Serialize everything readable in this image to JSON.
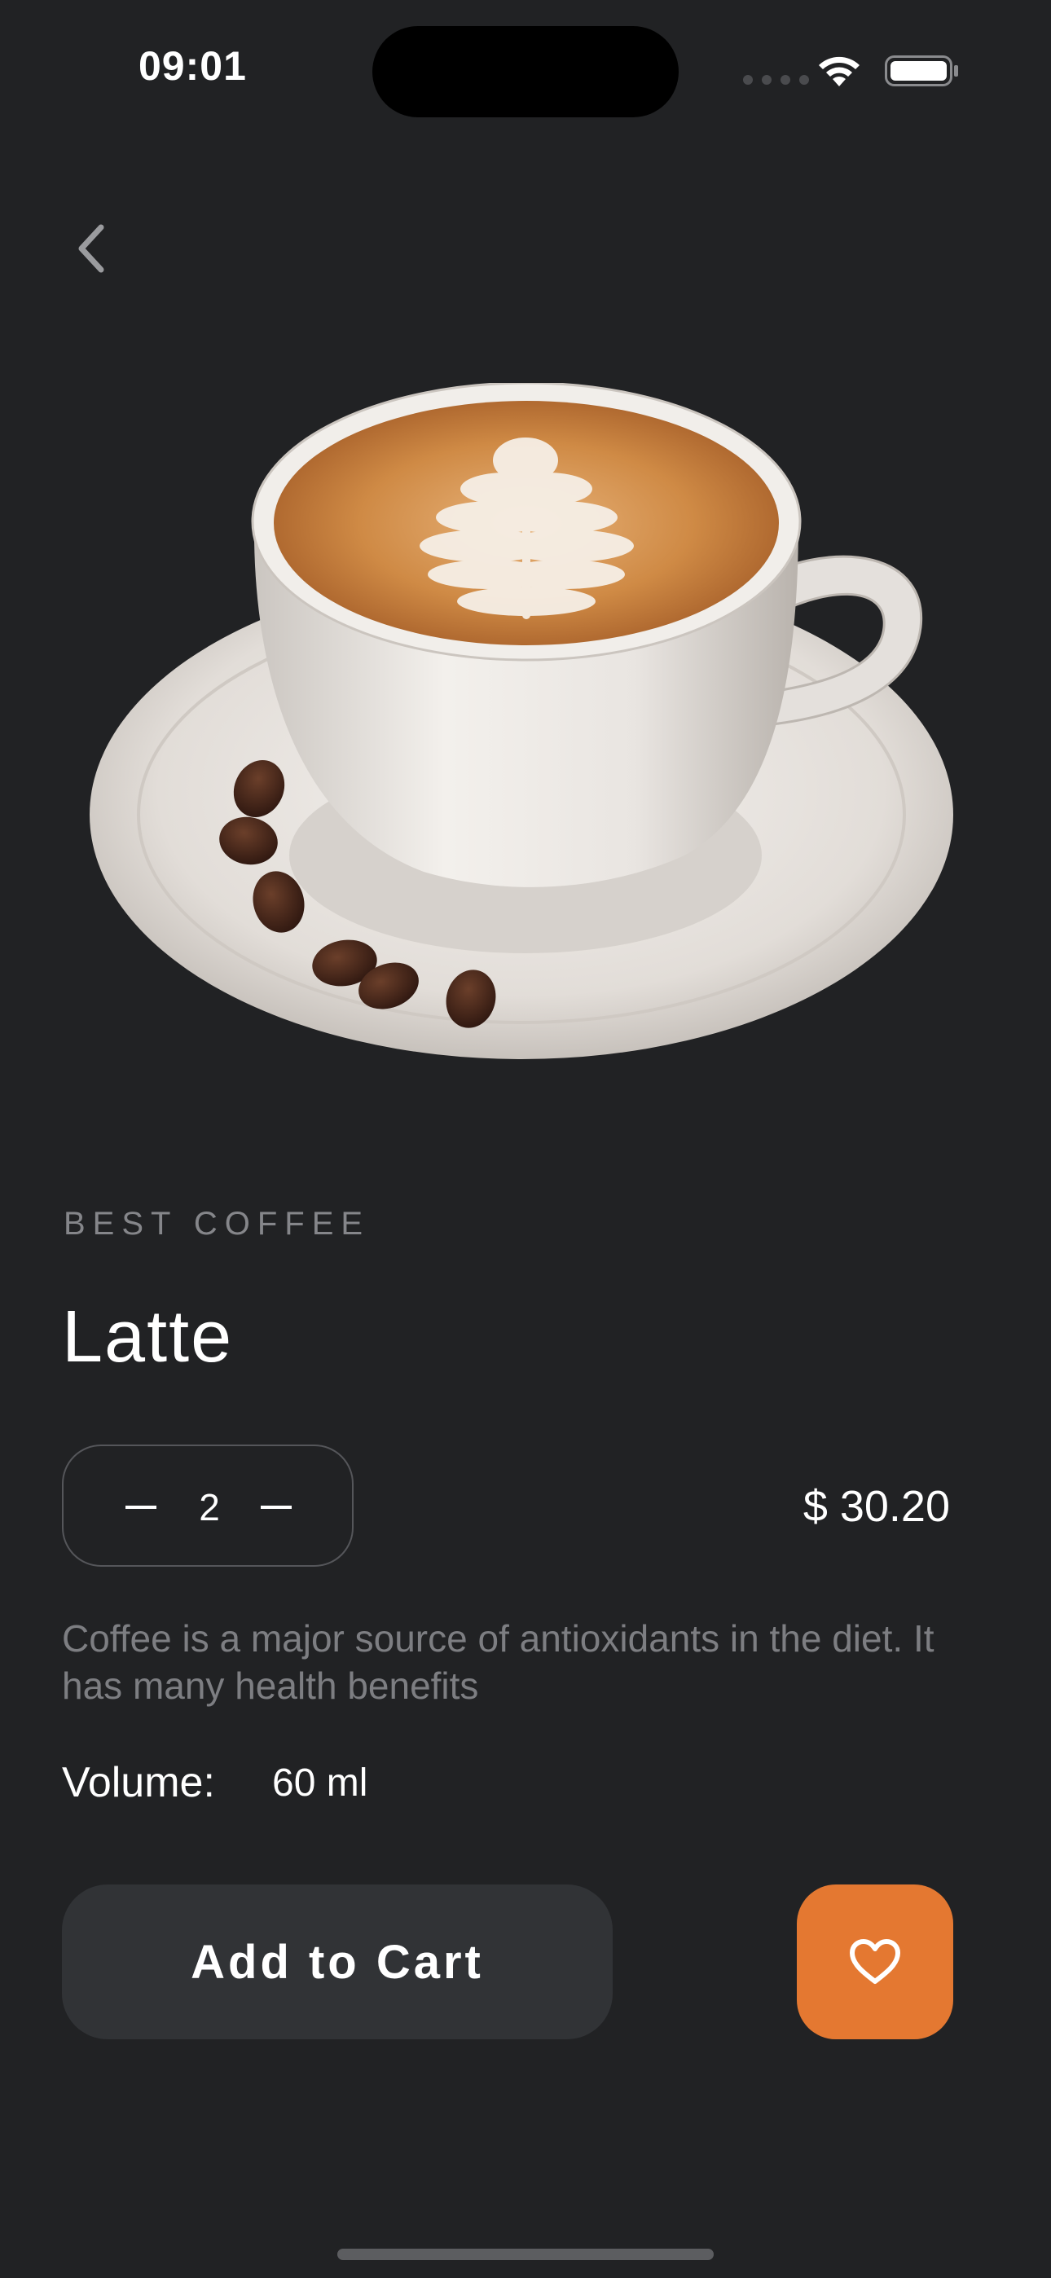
{
  "status_bar": {
    "time": "09:01"
  },
  "product": {
    "category": "BEST COFFEE",
    "name": "Latte",
    "quantity": "2",
    "price": "$ 30.20",
    "description": "Coffee is a major source of antioxidants in the diet. It has many health benefits",
    "volume_label": "Volume:",
    "volume_value": "60 ml"
  },
  "actions": {
    "add_to_cart": "Add to Cart"
  },
  "icons": {
    "back": "chevron-left-icon",
    "favorite": "heart-icon",
    "decrease": "minus-icon",
    "increase": "minus-icon"
  },
  "colors": {
    "background": "#212224",
    "accent": "#e47831",
    "button_dark": "#313336",
    "muted_text": "#7d7e82"
  }
}
